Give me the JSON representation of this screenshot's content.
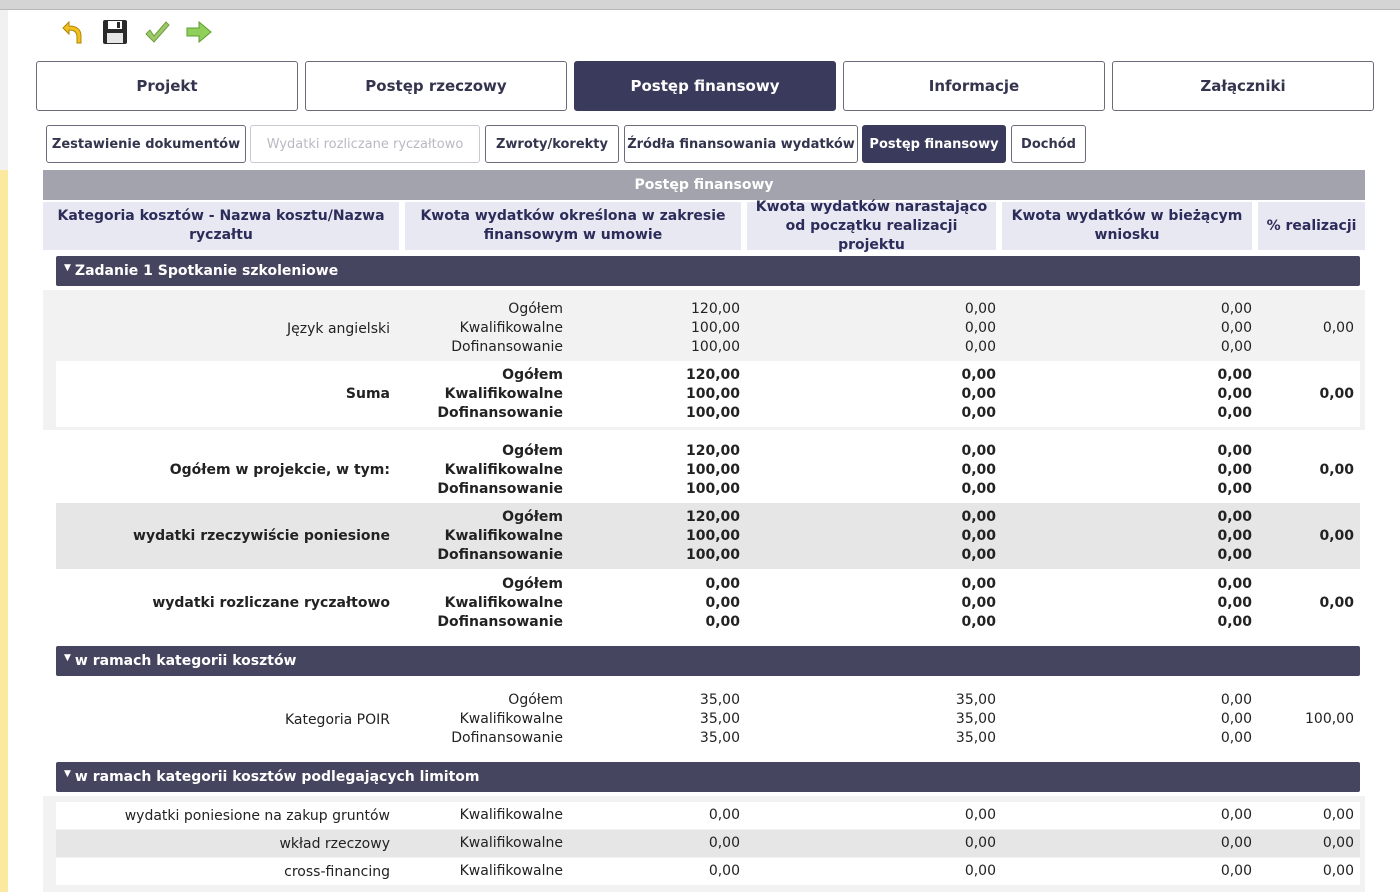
{
  "toolbar": {
    "icons": [
      "undo-icon",
      "save-icon",
      "validate-check-icon",
      "forward-arrow-icon"
    ]
  },
  "main_tabs": [
    {
      "label": "Projekt",
      "active": false
    },
    {
      "label": "Postęp rzeczowy",
      "active": false
    },
    {
      "label": "Postęp finansowy",
      "active": true
    },
    {
      "label": "Informacje",
      "active": false
    },
    {
      "label": "Załączniki",
      "active": false
    }
  ],
  "sub_tabs": [
    {
      "label": "Zestawienie dokumentów",
      "state": "normal"
    },
    {
      "label": "Wydatki rozliczane ryczałtowo",
      "state": "disabled"
    },
    {
      "label": "Zwroty/korekty",
      "state": "normal"
    },
    {
      "label": "Źródła finansowania wydatków",
      "state": "normal"
    },
    {
      "label": "Postęp finansowy",
      "state": "active"
    },
    {
      "label": "Dochód",
      "state": "normal"
    }
  ],
  "panel_title": "Postęp finansowy",
  "columns": {
    "category": "Kategoria kosztów - Nazwa kosztu/Nazwa ryczałtu",
    "contract": "Kwota wydatków określona w zakresie finansowym w umowie",
    "cumulative": "Kwota wydatków narastająco od początku realizacji projektu",
    "current": "Kwota wydatków w bieżącym wniosku",
    "percent": "% realizacji"
  },
  "sections": {
    "task": "Zadanie 1 Spotkanie szkoleniowe",
    "categories": "w ramach kategorii kosztów",
    "limits": "w ramach kategorii kosztów podlegających limitom"
  },
  "value_types": [
    "Ogółem",
    "Kwalifikowalne",
    "Dofinansowanie"
  ],
  "task_rows": [
    {
      "name": "Język angielski",
      "contract": [
        "120,00",
        "100,00",
        "100,00"
      ],
      "cumulative": [
        "0,00",
        "0,00",
        "0,00"
      ],
      "current": [
        "0,00",
        "0,00",
        "0,00"
      ],
      "percent": "0,00"
    },
    {
      "name": "Suma",
      "contract": [
        "120,00",
        "100,00",
        "100,00"
      ],
      "cumulative": [
        "0,00",
        "0,00",
        "0,00"
      ],
      "current": [
        "0,00",
        "0,00",
        "0,00"
      ],
      "percent": "0,00"
    }
  ],
  "project_rows": [
    {
      "name": "Ogółem w projekcie, w tym:",
      "contract": [
        "120,00",
        "100,00",
        "100,00"
      ],
      "cumulative": [
        "0,00",
        "0,00",
        "0,00"
      ],
      "current": [
        "0,00",
        "0,00",
        "0,00"
      ],
      "percent": "0,00"
    },
    {
      "name": "wydatki rzeczywiście poniesione",
      "contract": [
        "120,00",
        "100,00",
        "100,00"
      ],
      "cumulative": [
        "0,00",
        "0,00",
        "0,00"
      ],
      "current": [
        "0,00",
        "0,00",
        "0,00"
      ],
      "percent": "0,00"
    },
    {
      "name": "wydatki rozliczane ryczałtowo",
      "contract": [
        "0,00",
        "0,00",
        "0,00"
      ],
      "cumulative": [
        "0,00",
        "0,00",
        "0,00"
      ],
      "current": [
        "0,00",
        "0,00",
        "0,00"
      ],
      "percent": "0,00"
    }
  ],
  "category_rows": [
    {
      "name": "Kategoria POIR",
      "contract": [
        "35,00",
        "35,00",
        "35,00"
      ],
      "cumulative": [
        "35,00",
        "35,00",
        "35,00"
      ],
      "current": [
        "0,00",
        "0,00",
        "0,00"
      ],
      "percent": "100,00"
    }
  ],
  "limit_rows": [
    {
      "name": "wydatki poniesione na zakup gruntów",
      "type": "Kwalifikowalne",
      "contract": "0,00",
      "cumulative": "0,00",
      "current": "0,00",
      "percent": "0,00"
    },
    {
      "name": "wkład rzeczowy",
      "type": "Kwalifikowalne",
      "contract": "0,00",
      "cumulative": "0,00",
      "current": "0,00",
      "percent": "0,00"
    },
    {
      "name": "cross-financing",
      "type": "Kwalifikowalne",
      "contract": "0,00",
      "cumulative": "0,00",
      "current": "0,00",
      "percent": "0,00"
    }
  ]
}
